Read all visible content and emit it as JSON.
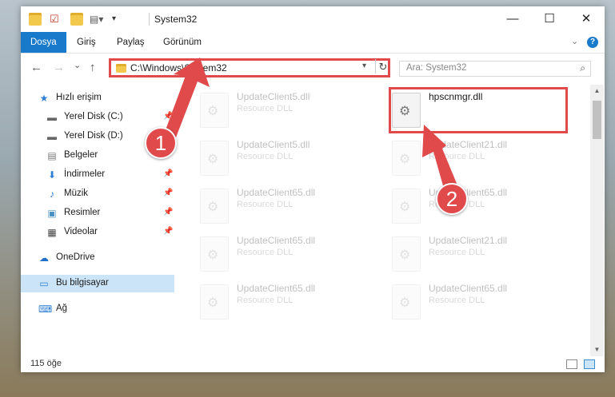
{
  "window": {
    "title": "System32",
    "controls": {
      "minimize": "—",
      "maximize": "☐",
      "close": "✕"
    }
  },
  "ribbon": {
    "tabs": [
      {
        "label": "Dosya",
        "active": true
      },
      {
        "label": "Giriş",
        "active": false
      },
      {
        "label": "Paylaş",
        "active": false
      },
      {
        "label": "Görünüm",
        "active": false
      }
    ],
    "help": "?"
  },
  "nav": {
    "back": "←",
    "forward": "→",
    "recent": "⌄",
    "up": "↑",
    "address": "C:\\Windows\\System32",
    "search_placeholder": "Ara: System32"
  },
  "sidebar": {
    "items": [
      {
        "label": "Hızlı erişim",
        "icon": "star-icon",
        "glyph": "★",
        "color": "#2d7dd2"
      },
      {
        "label": "Yerel Disk (C:)",
        "icon": "drive-icon",
        "glyph": "▬",
        "color": "#666666"
      },
      {
        "label": "Yerel Disk (D:)",
        "icon": "drive-icon",
        "glyph": "▬",
        "color": "#666666"
      },
      {
        "label": "Belgeler",
        "icon": "documents-icon",
        "glyph": "▤",
        "color": "#7a7a7a"
      },
      {
        "label": "İndirmeler",
        "icon": "download-icon",
        "glyph": "⬇",
        "color": "#2d7dd2"
      },
      {
        "label": "Müzik",
        "icon": "music-icon",
        "glyph": "♪",
        "color": "#2d7dd2"
      },
      {
        "label": "Resimler",
        "icon": "pictures-icon",
        "glyph": "▣",
        "color": "#4a90c2"
      },
      {
        "label": "Videolar",
        "icon": "videos-icon",
        "glyph": "▦",
        "color": "#444444"
      },
      {
        "label": "OneDrive",
        "icon": "cloud-icon",
        "glyph": "☁",
        "color": "#1f6fc6"
      },
      {
        "label": "Bu bilgisayar",
        "icon": "computer-icon",
        "glyph": "▭",
        "color": "#2d7dd2"
      },
      {
        "label": "Ağ",
        "icon": "network-icon",
        "glyph": "⌨",
        "color": "#2d7dd2"
      }
    ]
  },
  "files": {
    "left_column": [
      {
        "name": "UpdateClient5.dll",
        "type": "Resource DLL"
      },
      {
        "name": "UpdateClient5.dll",
        "type": "Resource DLL"
      },
      {
        "name": "UpdateClient65.dll",
        "type": "Resource DLL"
      },
      {
        "name": "UpdateClient65.dll",
        "type": "Resource DLL"
      },
      {
        "name": "UpdateClient65.dll",
        "type": "Resource DLL"
      }
    ],
    "right_column": [
      {
        "name": "hpscnmgr.dll",
        "type": ""
      },
      {
        "name": "UpdateClient21.dll",
        "type": "Resource DLL"
      },
      {
        "name": "UpdateClient65.dll",
        "type": "Resource DLL"
      },
      {
        "name": "UpdateClient21.dll",
        "type": "Resource DLL"
      },
      {
        "name": "UpdateClient65.dll",
        "type": "Resource DLL"
      }
    ]
  },
  "status": {
    "count": "115 öğe"
  },
  "annotations": {
    "badge1": "1",
    "badge2": "2",
    "color": "#e04a4a"
  }
}
